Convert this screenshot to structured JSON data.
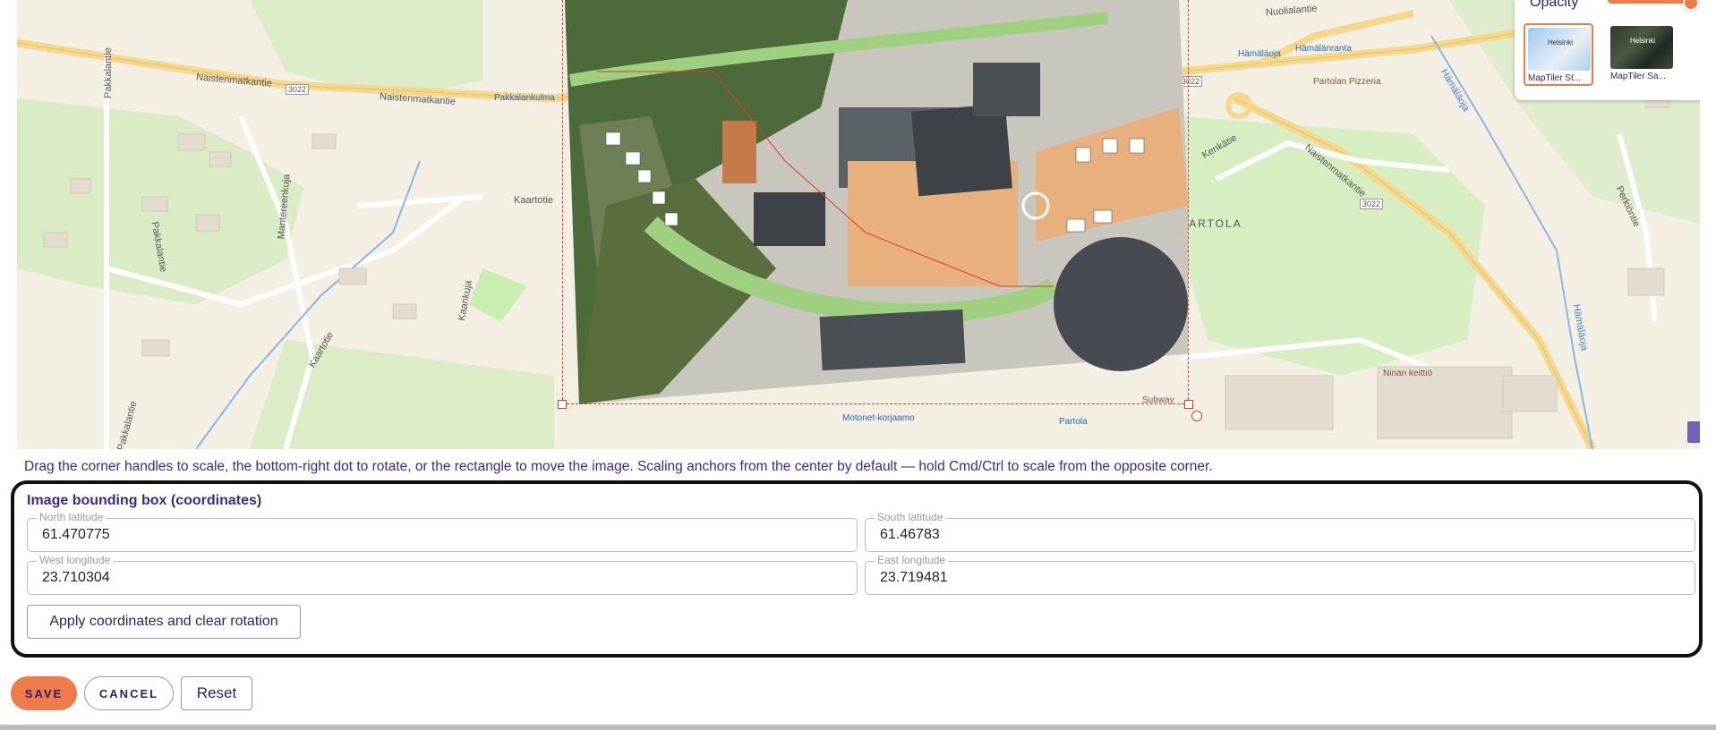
{
  "map": {
    "labels": {
      "naistenmatkantie_1": "Naistenmatkantie",
      "naistenmatkantie_2": "Naistenmatkantie",
      "naistenmatkantie_3": "Naistenmatkantie",
      "road_3022_a": "3022",
      "road_3022_b": "3022",
      "road_3022_c": "3022",
      "pakkalantie_1": "Pakkalantie",
      "pakkalantie_2": "Pakkalantie",
      "pakkalantie_3": "Pakkalantie",
      "mantereenkuja": "Mantereenkuja",
      "kaartotie_1": "Kaartotie",
      "kaartotie_2": "Kaartotie",
      "kaarikuja": "Kaarikuja",
      "nuolialantie": "Nuolialantie",
      "kenkatie": "Kenkätie",
      "hamalanoja_1": "Hämäläoja",
      "hamalanoja_2": "Hämäläoja",
      "perkiontie": "Perkiöntie",
      "district": "PARTOLA"
    },
    "pois": {
      "pakkalankulma": "Pakkalankulma",
      "hamalanoja": "Hämäläoja",
      "hamalanranta": "Hämälänranta",
      "partolan_pizzeria": "Partolan Pizzeria",
      "ninan_keittio": "Ninan keittiö",
      "motonet": "Motonet-korjaamo",
      "partola": "Partola",
      "subway": "Subway"
    },
    "layers": {
      "opacity_label": "Opacity",
      "opacity_value": 0.95,
      "streets_caption": "MapTiler St...",
      "satellite_caption": "MapTiler Sa...",
      "streets_thumb_text": "Helsinki",
      "satellite_thumb_text": "Helsinki",
      "selected": "streets"
    }
  },
  "hint": "Drag the corner handles to scale, the bottom-right dot to rotate, or the rectangle to move the image. Scaling anchors from the center by default — hold Cmd/Ctrl to scale from the opposite corner.",
  "bbox": {
    "title": "Image bounding box (coordinates)",
    "north_label": "North latitude",
    "north_value": "61.470775",
    "south_label": "South latitude",
    "south_value": "61.46783",
    "west_label": "West longitude",
    "west_value": "23.710304",
    "east_label": "East longitude",
    "east_value": "23.719481",
    "apply_label": "Apply coordinates and clear rotation"
  },
  "actions": {
    "save": "SAVE",
    "cancel": "CANCEL",
    "reset": "Reset"
  },
  "colors": {
    "accent": "#ef7b4b",
    "text": "#3a2a8c",
    "handle": "#e23a2a",
    "map_bg": "#f3efe2"
  }
}
